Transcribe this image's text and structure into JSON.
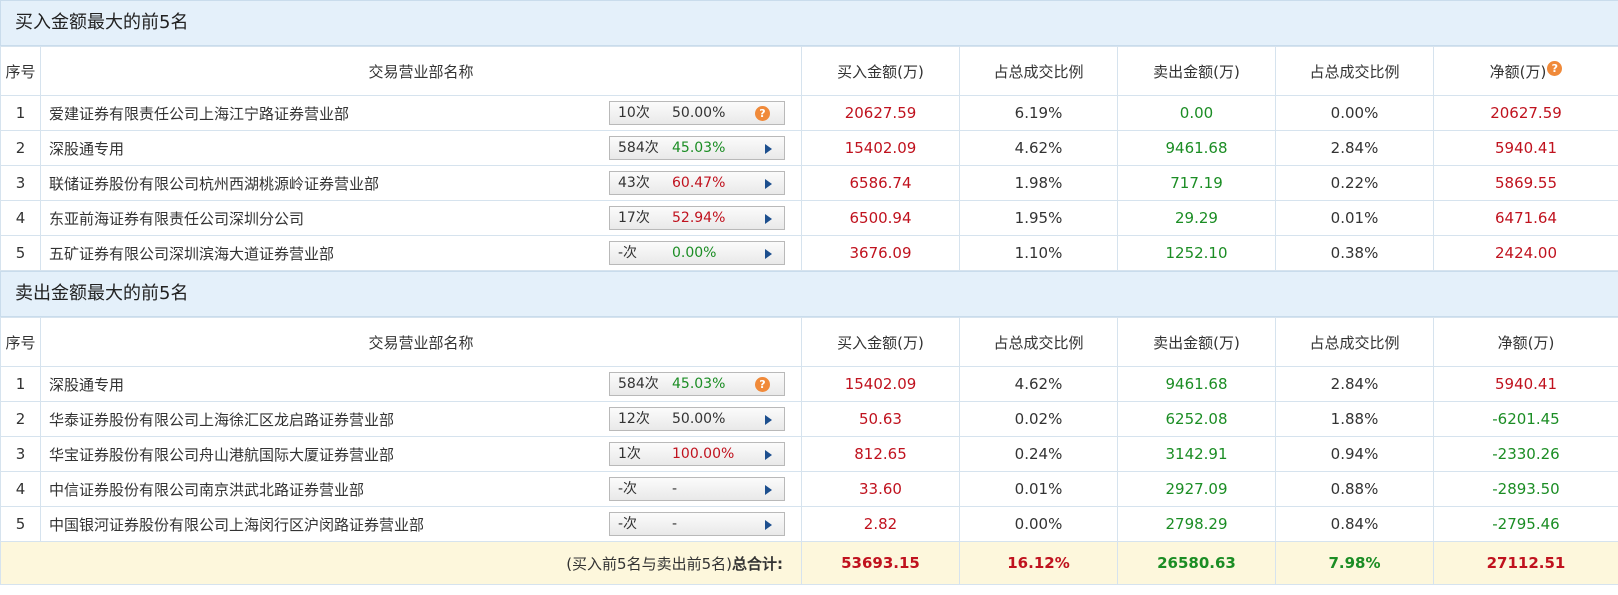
{
  "buy_section": {
    "title": "买入金额最大的前5名",
    "headers": [
      "序号",
      "交易营业部名称",
      "买入金额(万)",
      "占总成交比例",
      "卖出金额(万)",
      "占总成交比例",
      "净额(万)"
    ],
    "help_icon_glyph": "?",
    "rows": [
      {
        "idx": "1",
        "name": "爱建证券有限责任公司上海江宁路证券营业部",
        "count": "10次",
        "pct": "50.00%",
        "pct_color": "dark",
        "icon": "question-icon",
        "buy": "20627.59",
        "buy_ratio": "6.19%",
        "sell": "0.00",
        "sell_ratio": "0.00%",
        "net": "20627.59",
        "net_color": "red"
      },
      {
        "idx": "2",
        "name": "深股通专用",
        "count": "584次",
        "pct": "45.03%",
        "pct_color": "green",
        "icon": "arrow-right-icon",
        "buy": "15402.09",
        "buy_ratio": "4.62%",
        "sell": "9461.68",
        "sell_ratio": "2.84%",
        "net": "5940.41",
        "net_color": "red"
      },
      {
        "idx": "3",
        "name": "联储证券股份有限公司杭州西湖桃源岭证券营业部",
        "count": "43次",
        "pct": "60.47%",
        "pct_color": "red",
        "icon": "arrow-right-icon",
        "buy": "6586.74",
        "buy_ratio": "1.98%",
        "sell": "717.19",
        "sell_ratio": "0.22%",
        "net": "5869.55",
        "net_color": "red"
      },
      {
        "idx": "4",
        "name": "东亚前海证券有限责任公司深圳分公司",
        "count": "17次",
        "pct": "52.94%",
        "pct_color": "red",
        "icon": "arrow-right-icon",
        "buy": "6500.94",
        "buy_ratio": "1.95%",
        "sell": "29.29",
        "sell_ratio": "0.01%",
        "net": "6471.64",
        "net_color": "red"
      },
      {
        "idx": "5",
        "name": "五矿证券有限公司深圳滨海大道证券营业部",
        "count": "-次",
        "pct": "0.00%",
        "pct_color": "green",
        "icon": "arrow-right-icon",
        "buy": "3676.09",
        "buy_ratio": "1.10%",
        "sell": "1252.10",
        "sell_ratio": "0.38%",
        "net": "2424.00",
        "net_color": "red"
      }
    ]
  },
  "sell_section": {
    "title": "卖出金额最大的前5名",
    "headers": [
      "序号",
      "交易营业部名称",
      "买入金额(万)",
      "占总成交比例",
      "卖出金额(万)",
      "占总成交比例",
      "净额(万)"
    ],
    "rows": [
      {
        "idx": "1",
        "name": "深股通专用",
        "count": "584次",
        "pct": "45.03%",
        "pct_color": "green",
        "icon": "question-icon",
        "buy": "15402.09",
        "buy_ratio": "4.62%",
        "sell": "9461.68",
        "sell_ratio": "2.84%",
        "net": "5940.41",
        "net_color": "red"
      },
      {
        "idx": "2",
        "name": "华泰证券股份有限公司上海徐汇区龙启路证券营业部",
        "count": "12次",
        "pct": "50.00%",
        "pct_color": "dark",
        "icon": "arrow-right-icon",
        "buy": "50.63",
        "buy_ratio": "0.02%",
        "sell": "6252.08",
        "sell_ratio": "1.88%",
        "net": "-6201.45",
        "net_color": "green"
      },
      {
        "idx": "3",
        "name": "华宝证券股份有限公司舟山港航国际大厦证券营业部",
        "count": "1次",
        "pct": "100.00%",
        "pct_color": "red",
        "icon": "arrow-right-icon",
        "buy": "812.65",
        "buy_ratio": "0.24%",
        "sell": "3142.91",
        "sell_ratio": "0.94%",
        "net": "-2330.26",
        "net_color": "green"
      },
      {
        "idx": "4",
        "name": "中信证券股份有限公司南京洪武北路证券营业部",
        "count": "-次",
        "pct": "-",
        "pct_color": "dark",
        "icon": "arrow-right-icon",
        "buy": "33.60",
        "buy_ratio": "0.01%",
        "sell": "2927.09",
        "sell_ratio": "0.88%",
        "net": "-2893.50",
        "net_color": "green"
      },
      {
        "idx": "5",
        "name": "中国银河证券股份有限公司上海闵行区沪闵路证券营业部",
        "count": "-次",
        "pct": "-",
        "pct_color": "dark",
        "icon": "arrow-right-icon",
        "buy": "2.82",
        "buy_ratio": "0.00%",
        "sell": "2798.29",
        "sell_ratio": "0.84%",
        "net": "-2795.46",
        "net_color": "green"
      }
    ]
  },
  "total": {
    "label_prefix": "(买入前5名与卖出前5名)",
    "label_bold": "总合计:",
    "buy": "53693.15",
    "buy_ratio": "16.12%",
    "sell": "26580.63",
    "sell_ratio": "7.98%",
    "net": "27112.51"
  },
  "colors": {
    "red": "#c0121e",
    "green": "#1b8d24",
    "header_bg": "#e4f0fa",
    "total_bg": "#fdf7dc",
    "help_icon": "#f08a3a",
    "arrow": "#1d4f8e"
  }
}
